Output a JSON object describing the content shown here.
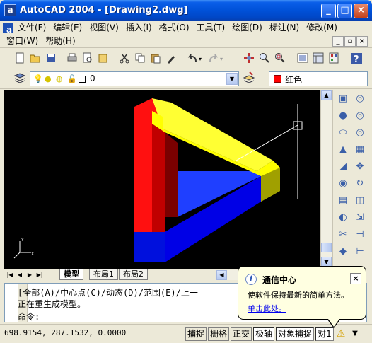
{
  "window": {
    "title": "AutoCAD 2004 - [Drawing2.dwg]",
    "app_icon": "a"
  },
  "menu": {
    "row1": [
      "文件(F)",
      "编辑(E)",
      "视图(V)",
      "插入(I)",
      "格式(O)",
      "工具(T)",
      "绘图(D)",
      "标注(N)",
      "修改(M)"
    ],
    "row2": [
      "窗口(W)",
      "帮助(H)"
    ]
  },
  "toolbar": {
    "icons": [
      "new-icon",
      "open-icon",
      "save-icon",
      "print-icon",
      "preview-icon",
      "publish-icon",
      "cut-icon",
      "copy-icon",
      "paste-icon",
      "matchprop-icon",
      "undo-icon",
      "redo-icon",
      "pan-icon",
      "zoom-realtime-icon",
      "zoom-window-icon",
      "properties-icon",
      "design-center-icon",
      "tool-palette-icon",
      "help-icon"
    ]
  },
  "layer": {
    "current": "0",
    "color_label": "红色",
    "color": "#ff0000"
  },
  "tabs": {
    "model": "模型",
    "layout1": "布局1",
    "layout2": "布局2"
  },
  "command": {
    "line1": "[全部(A)/中心点(C)/动态(D)/范围(E)/上一",
    "line2": "正在重生成模型。",
    "line3": "命令:"
  },
  "status": {
    "coords": "698.9154, 287.1532, 0.0000",
    "buttons": [
      "捕捉",
      "栅格",
      "正交",
      "极轴",
      "对象捕捉",
      "对象追踪"
    ],
    "visible": [
      "捕捉",
      "栅格",
      "正交",
      "极轴",
      "对象捕捉",
      "对1"
    ]
  },
  "balloon": {
    "title": "通信中心",
    "body": "使软件保持最新的简单方法。",
    "link": "单击此处。"
  },
  "colors": {
    "red_face": "#ff0000",
    "yellow_face": "#ffff00",
    "blue_face": "#0000ff"
  }
}
